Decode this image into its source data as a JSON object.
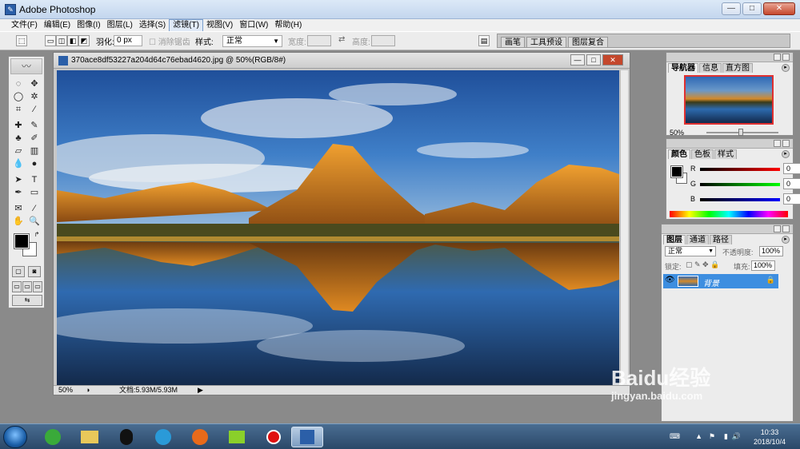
{
  "window": {
    "title": "Adobe Photoshop",
    "min": "—",
    "max": "□",
    "close": "✕"
  },
  "menu": [
    "文件(F)",
    "编辑(E)",
    "图像(I)",
    "图层(L)",
    "选择(S)",
    "滤镜(T)",
    "视图(V)",
    "窗口(W)",
    "帮助(H)"
  ],
  "options": {
    "feather_label": "羽化:",
    "feather_value": "0 px",
    "antialias_label": "消除锯齿",
    "style_label": "样式:",
    "style_value": "正常",
    "width_label": "宽度:",
    "height_label": "高度:",
    "swap": "⇄",
    "palette_tabs": [
      "画笔",
      "工具预设",
      "图层复合"
    ]
  },
  "document": {
    "title": "370ace8df53227a204d64c76ebad4620.jpg @ 50%(RGB/8#)",
    "zoom": "50%",
    "doc_info": "文档:5.93M/5.93M"
  },
  "navigator": {
    "tabs": [
      "导航器",
      "信息",
      "直方图"
    ],
    "zoom": "50%"
  },
  "color_panel": {
    "tabs": [
      "颜色",
      "色板",
      "样式"
    ],
    "r_label": "R",
    "g_label": "G",
    "b_label": "B",
    "r": "0",
    "g": "0",
    "b": "0"
  },
  "layers": {
    "tabs": [
      "图层",
      "通道",
      "路径"
    ],
    "blend_mode": "正常",
    "opacity_label": "不透明度:",
    "opacity": "100%",
    "lock_label": "锁定:",
    "fill_label": "填充:",
    "fill": "100%",
    "layer_name": "背景"
  },
  "taskbar": {
    "time": "10:33",
    "date": "2018/10/4"
  },
  "watermark": {
    "brand": "Baidu经验",
    "url": "jingyan.baidu.com"
  },
  "colors": {
    "accent_selected": "#3d8ee0",
    "title_bar": "#c3d6ee",
    "taskbar": "#2a4868"
  }
}
